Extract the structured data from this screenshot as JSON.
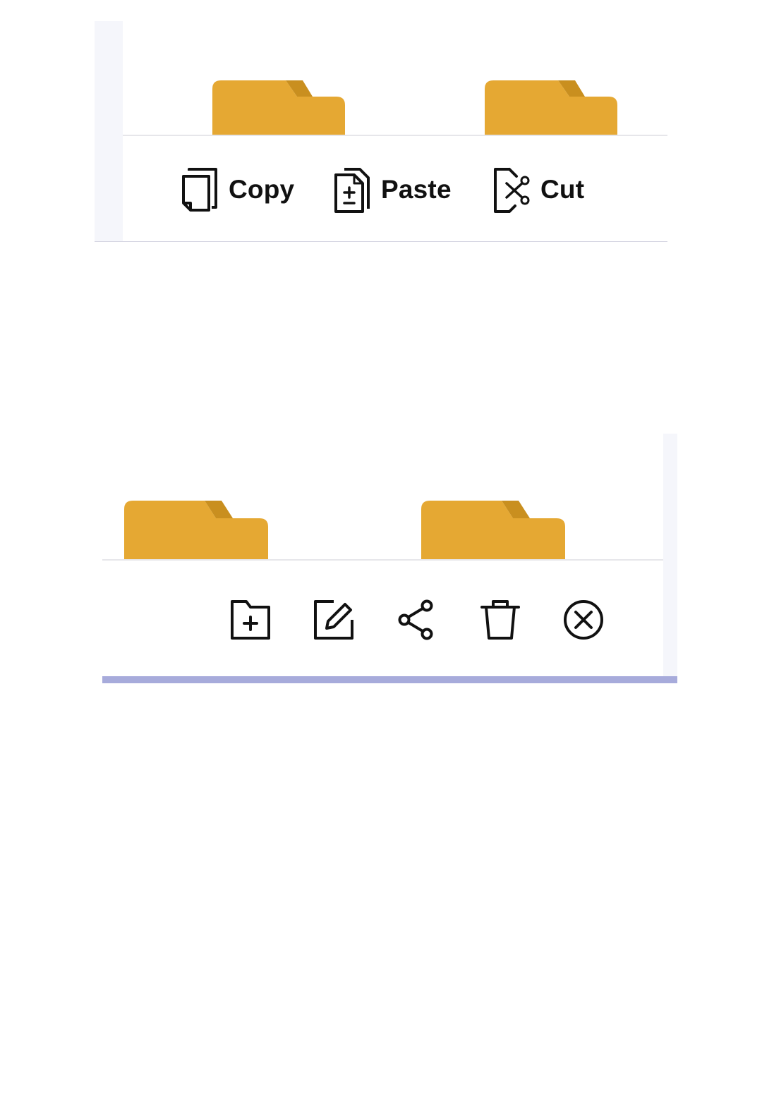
{
  "colors": {
    "folder_body": "#E5A833",
    "folder_tab_fold": "#C98F1F",
    "icon_stroke": "#111111",
    "accent_bar": "#A7ABDB",
    "side_strip": "#F5F6FB",
    "divider": "#E6E6EA"
  },
  "clipboard_toolbar": {
    "buttons": [
      {
        "id": "copy",
        "label": "Copy",
        "icon": "copy-icon"
      },
      {
        "id": "paste",
        "label": "Paste",
        "icon": "paste-icon"
      },
      {
        "id": "cut",
        "label": "Cut",
        "icon": "cut-icon"
      }
    ],
    "folders": [
      "folder-icon",
      "folder-icon"
    ]
  },
  "action_toolbar": {
    "buttons": [
      {
        "id": "new-folder",
        "icon": "new-folder-icon"
      },
      {
        "id": "rename",
        "icon": "edit-icon"
      },
      {
        "id": "share",
        "icon": "share-icon"
      },
      {
        "id": "delete",
        "icon": "trash-icon"
      },
      {
        "id": "close",
        "icon": "close-circle-icon"
      }
    ],
    "folders": [
      "folder-icon",
      "folder-icon"
    ]
  }
}
